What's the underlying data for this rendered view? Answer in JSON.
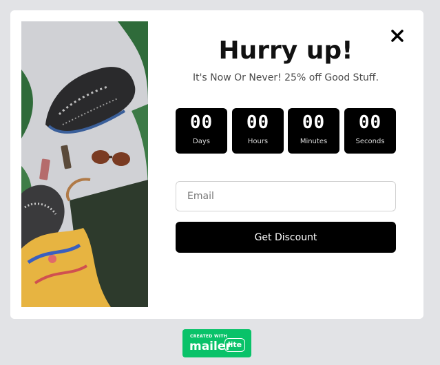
{
  "popup": {
    "title": "Hurry up!",
    "subtitle": "It's Now Or Never! 25% off Good Stuff.",
    "close_icon": "close-icon",
    "image_icon": "product-photo"
  },
  "countdown": [
    {
      "value": "00",
      "label": "Days"
    },
    {
      "value": "00",
      "label": "Hours"
    },
    {
      "value": "00",
      "label": "Minutes"
    },
    {
      "value": "00",
      "label": "Seconds"
    }
  ],
  "form": {
    "email_placeholder": "Email",
    "email_value": "",
    "submit_label": "Get Discount"
  },
  "footer": {
    "badge_small": "CREATED WITH",
    "badge_brand": "mailer",
    "badge_pill": "lite",
    "badge_color": "#09c269"
  },
  "colors": {
    "background": "#e2e3e6",
    "button": "#000000",
    "timer_box": "#000000"
  }
}
